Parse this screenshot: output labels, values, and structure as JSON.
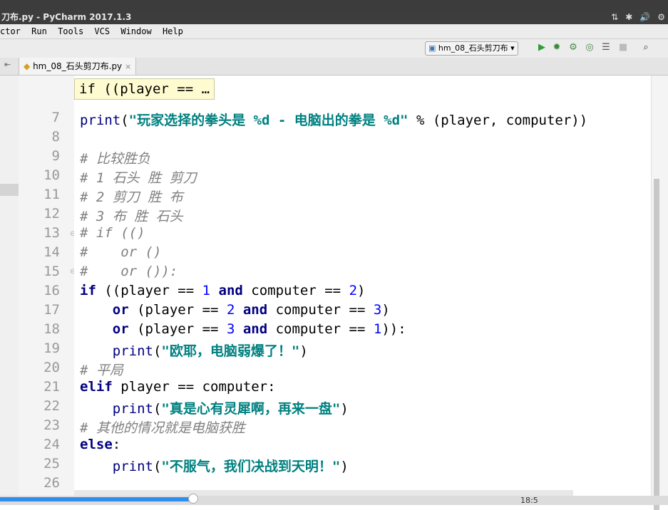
{
  "window": {
    "title": "刀布.py - PyCharm 2017.1.3"
  },
  "menu": [
    "ctor",
    "Run",
    "Tools",
    "VCS",
    "Window",
    "Help"
  ],
  "toolbar": {
    "run_config": "hm_08_石头剪刀布"
  },
  "tab": {
    "label": "hm_08_石头剪刀布.py",
    "close": "×"
  },
  "hint": "if ((player == …",
  "code": {
    "line_numbers": [
      "7",
      "8",
      "9",
      "10",
      "11",
      "12",
      "13",
      "14",
      "15",
      "16",
      "17",
      "18",
      "19",
      "20",
      "21",
      "22",
      "23",
      "24",
      "25",
      "26"
    ],
    "current_line": "18"
  },
  "status": {
    "position": "18:5"
  }
}
